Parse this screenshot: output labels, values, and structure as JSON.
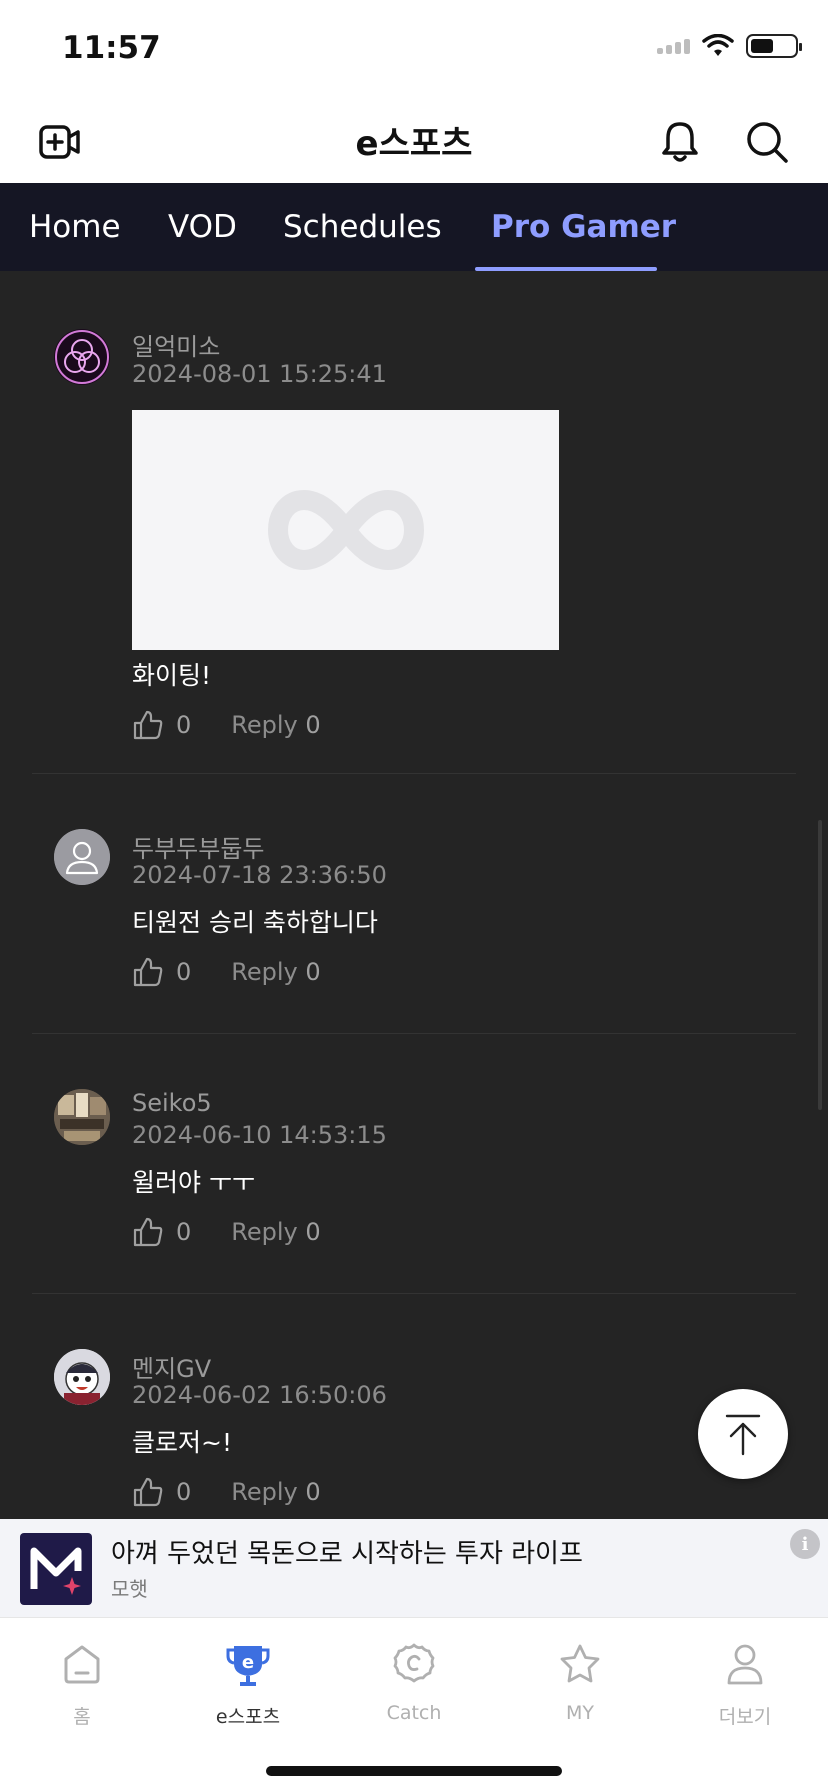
{
  "status_bar": {
    "time": "11:57"
  },
  "header": {
    "title": "e스포츠"
  },
  "tabs": [
    {
      "label": "Home"
    },
    {
      "label": "VOD"
    },
    {
      "label": "Schedules"
    },
    {
      "label": "Pro Gamer"
    }
  ],
  "comments": [
    {
      "nickname": "일억미소",
      "date": "2024-08-01 15:25:41",
      "text": "화이팅!",
      "likes": "0",
      "reply_label": "Reply",
      "reply_count": "0",
      "has_image": true
    },
    {
      "nickname": "두부두부둡두",
      "date": "2024-07-18 23:36:50",
      "text": "티원전 승리 축하합니다",
      "likes": "0",
      "reply_label": "Reply",
      "reply_count": "0"
    },
    {
      "nickname": "Seiko5",
      "date": "2024-06-10 14:53:15",
      "text": "윌러야 ㅜㅜ",
      "likes": "0",
      "reply_label": "Reply",
      "reply_count": "0"
    },
    {
      "nickname": "멘지GV",
      "date": "2024-06-02 16:50:06",
      "text": "클로저~!",
      "likes": "0",
      "reply_label": "Reply",
      "reply_count": "0"
    }
  ],
  "ad": {
    "title": "아껴 두었던 목돈으로 시작하는 투자 라이프",
    "advertiser": "모햇"
  },
  "bottom_nav": [
    {
      "label": "홈",
      "icon": "home-icon"
    },
    {
      "label": "e스포츠",
      "icon": "esports-icon"
    },
    {
      "label": "Catch",
      "icon": "catch-icon"
    },
    {
      "label": "MY",
      "icon": "star-icon"
    },
    {
      "label": "더보기",
      "icon": "person-icon"
    }
  ],
  "colors": {
    "accent": "#8e9dff",
    "tab_bar": "#151624",
    "background": "#242424",
    "esports_blue": "#3d6fe0"
  }
}
